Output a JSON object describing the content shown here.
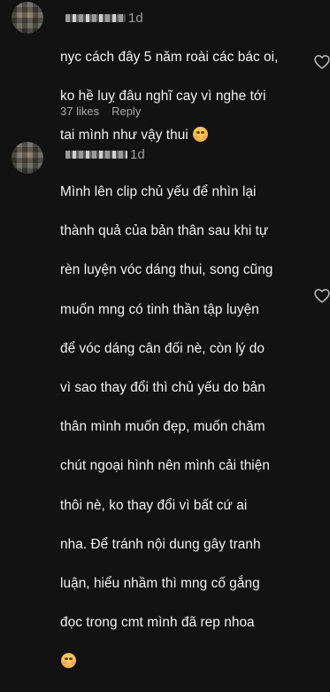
{
  "comments": [
    {
      "time": "1d",
      "lines": [
        "nyc cách đây 5 năm roài các bác oi,",
        "ko hề luỵ đâu nghĩ cay vì nghe tới",
        "tai mình như vậy thui"
      ],
      "emoji": "smiling-face-emoji",
      "likes": "37 likes",
      "reply": "Reply"
    },
    {
      "time": "1d",
      "lines": [
        "Mình lên clip chủ yếu để nhìn lại",
        "thành quả của bản thân sau khi tự",
        "rèn luyện vóc dáng thui, song cũng",
        "muốn mng có tinh thần tập luyện",
        "để vóc dáng cân đối nè, còn lý do",
        "vì sao thay đổi thì chủ yếu do bản",
        "thân mình muốn đẹp, muốn chăm",
        "chút ngoại hình nên mình cải thiện",
        "thôi nè, ko thay đổi vì bất cứ ai",
        "nha. Để tránh nội dung gây tranh",
        "luận, hiểu nhầm thì mng cố gắng",
        "đọc trong cmt mình đã rep nhoa"
      ],
      "emoji": "kissing-face-emoji"
    }
  ],
  "colors": {
    "background": "#121212",
    "text": "#f1f1f1",
    "muted": "#a8a8a8"
  }
}
